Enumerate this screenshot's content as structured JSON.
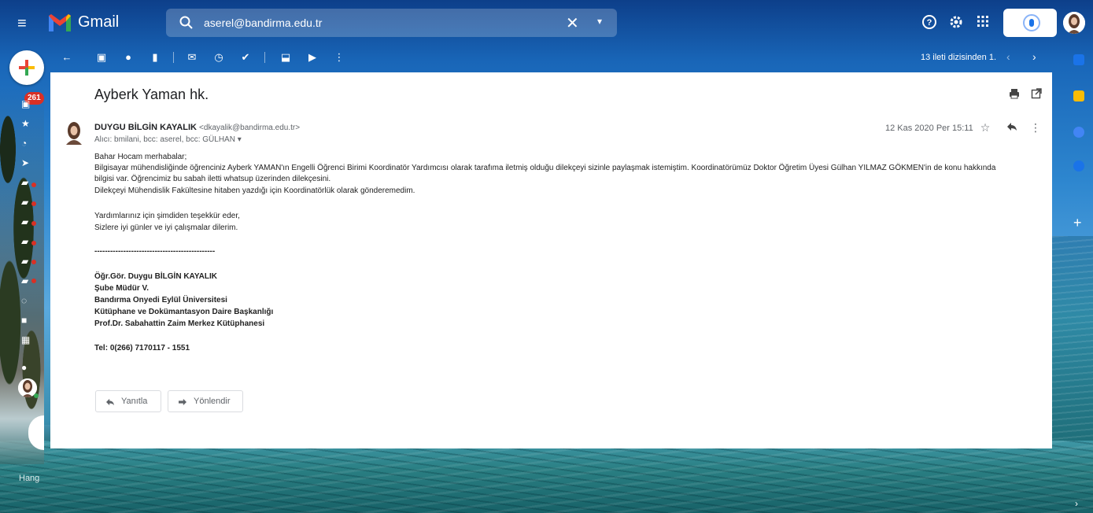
{
  "app": {
    "brand": "Gmail",
    "unread_badge": "261"
  },
  "search": {
    "query": "aserel@bandirma.edu.tr",
    "clear": "✕",
    "options": "▾"
  },
  "pager": {
    "label": "13 ileti dizisinden 1.",
    "prev": "‹",
    "next": "›"
  },
  "message": {
    "subject": "Ayberk Yaman hk.",
    "sender_name": "DUYGU BİLGİN KAYALIK",
    "sender_email": "<dkayalik@bandirma.edu.tr>",
    "recipients": "Alıcı: bmilani, bcc: aserel, bcc: GÜLHAN",
    "date": "12 Kas 2020 Per 15:11",
    "body": {
      "l1": "Bahar Hocam merhabalar;",
      "l2": "Bilgisayar mühendisliğinde öğrenciniz Ayberk YAMAN'ın Engelli Öğrenci Birimi Koordinatör Yardımcısı olarak tarafıma iletmiş olduğu dilekçeyi sizinle paylaşmak istemiştim. Koordinatörümüz Doktor Öğretim Üyesi Gülhan YILMAZ GÖKMEN'in de konu hakkında",
      "l3": "bilgisi var. Öğrencimiz bu sabah iletti whatsup üzerinden dilekçesini.",
      "l4": "Dilekçeyi Mühendislik Fakültesine hitaben yazdığı için Koordinatörlük olarak gönderemedim.",
      "l5": "Yardımlarınız için şimdiden teşekkür eder,",
      "l6": "Sizlere iyi günler ve iyi çalışmalar dilerim.",
      "separator": "----------------------------------------------",
      "sig1": "Öğr.Gör. Duygu BİLGİN KAYALIK",
      "sig2": "Şube Müdür V.",
      "sig3": "Bandırma Onyedi Eylül Üniversitesi",
      "sig4": "Kütüphane ve Dokümantasyon Daire Başkanlığı",
      "sig5": "Prof.Dr. Sabahattin Zaim Merkez Kütüphanesi",
      "tel": "Tel: 0(266) 7170117 - 1551"
    },
    "reply_label": "Yanıtla",
    "forward_label": "Yönlendir"
  },
  "rail": {
    "hangouts_label": "Hang"
  },
  "colors": {
    "accent": "#1a73e8",
    "badge": "#d93025"
  }
}
